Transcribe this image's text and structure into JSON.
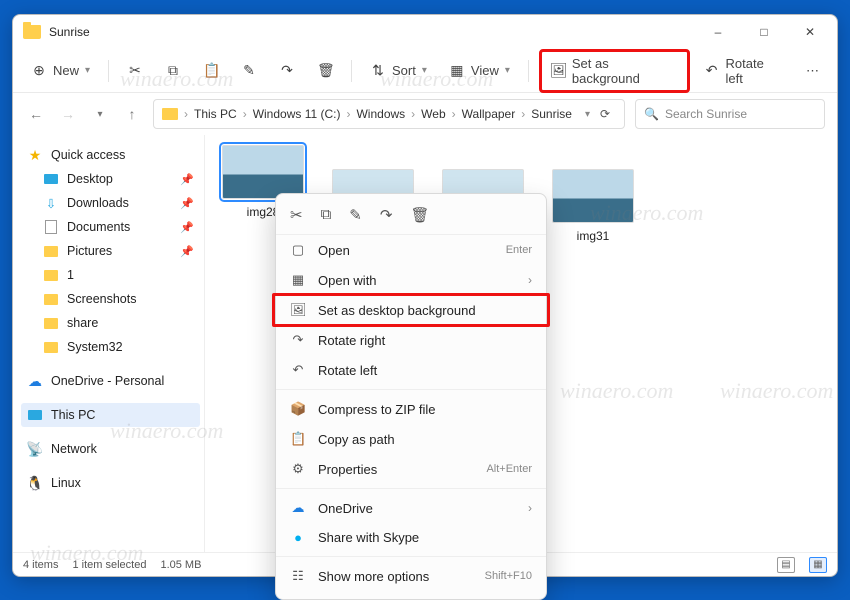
{
  "window": {
    "title": "Sunrise"
  },
  "toolbar": {
    "new": "New",
    "sort": "Sort",
    "view": "View",
    "set_bg": "Set as background",
    "rotate_left": "Rotate left"
  },
  "breadcrumb": {
    "items": [
      "This PC",
      "Windows 11 (C:)",
      "Windows",
      "Web",
      "Wallpaper",
      "Sunrise"
    ]
  },
  "search": {
    "placeholder": "Search Sunrise"
  },
  "sidebar": {
    "quick": "Quick access",
    "desktop": "Desktop",
    "downloads": "Downloads",
    "documents": "Documents",
    "pictures": "Pictures",
    "f1": "1",
    "screenshots": "Screenshots",
    "share": "share",
    "system32": "System32",
    "onedrive": "OneDrive - Personal",
    "thispc": "This PC",
    "network": "Network",
    "linux": "Linux"
  },
  "thumbs": {
    "img28": "img28",
    "img31": "img31"
  },
  "ctx": {
    "open": "Open",
    "open_kb": "Enter",
    "openwith": "Open with",
    "setbg": "Set as desktop background",
    "rotr": "Rotate right",
    "rotl": "Rotate left",
    "zip": "Compress to ZIP file",
    "copypath": "Copy as path",
    "props": "Properties",
    "props_kb": "Alt+Enter",
    "onedrive": "OneDrive",
    "skype": "Share with Skype",
    "more": "Show more options",
    "more_kb": "Shift+F10"
  },
  "status": {
    "count": "4 items",
    "selected": "1 item selected",
    "size": "1.05 MB"
  },
  "watermark": "winaero.com"
}
